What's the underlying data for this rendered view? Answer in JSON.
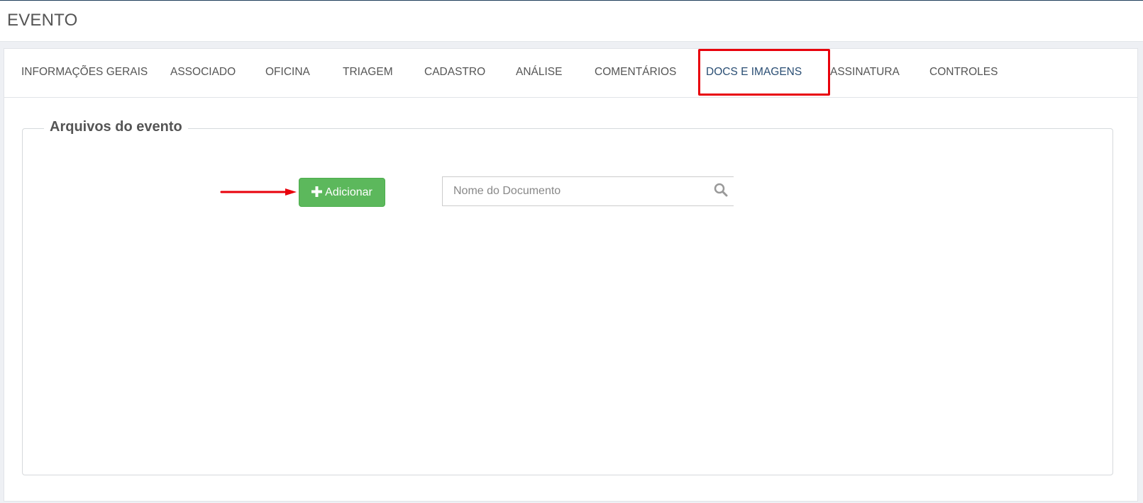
{
  "header": {
    "title": "EVENTO"
  },
  "tabs": [
    {
      "label": "INFORMAÇÕES GERAIS"
    },
    {
      "label": "ASSOCIADO"
    },
    {
      "label": "OFICINA"
    },
    {
      "label": "TRIAGEM"
    },
    {
      "label": "CADASTRO"
    },
    {
      "label": "ANÁLISE"
    },
    {
      "label": "COMENTÁRIOS"
    },
    {
      "label": "DOCS E IMAGENS",
      "active": true
    },
    {
      "label": "ASSINATURA"
    },
    {
      "label": "CONTROLES"
    }
  ],
  "files_section": {
    "legend": "Arquivos do evento",
    "add_button": {
      "label": "Adicionar",
      "icon": "plus-icon"
    },
    "search": {
      "placeholder": "Nome do Documento",
      "value": "",
      "icon": "search-icon"
    }
  },
  "colors": {
    "active_tab": "#2a4e74",
    "highlight": "#e8000b",
    "add_button": "#5cb85c"
  }
}
